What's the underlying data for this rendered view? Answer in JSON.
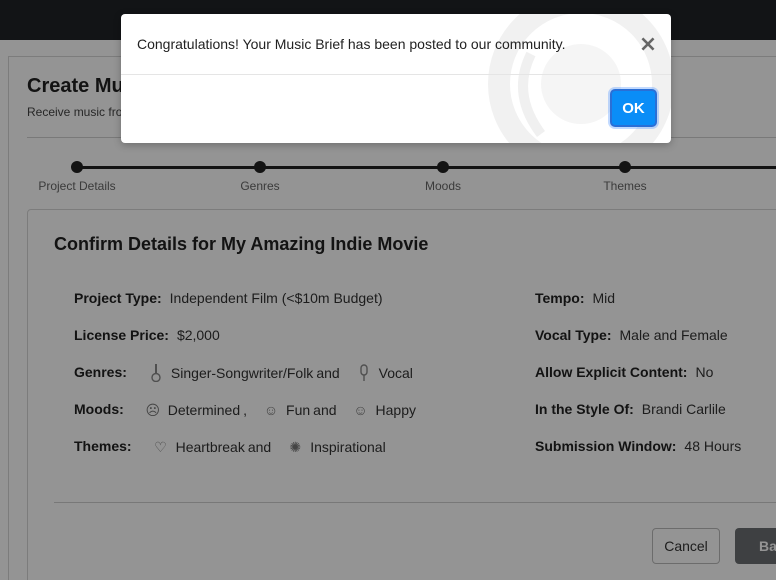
{
  "page": {
    "title": "Create Music Brief",
    "subtitle": "Receive music from our community"
  },
  "steps": [
    {
      "label": "Project Details"
    },
    {
      "label": "Genres"
    },
    {
      "label": "Moods"
    },
    {
      "label": "Themes"
    }
  ],
  "confirm": {
    "title": "Confirm Details for My Amazing Indie Movie",
    "left": {
      "project_type": {
        "label": "Project Type:",
        "value": "Independent Film (<$10m Budget)"
      },
      "license_price": {
        "label": "License Price:",
        "value": "$2,000"
      },
      "genres": {
        "label": "Genres:",
        "items": [
          {
            "icon": "guitar-icon",
            "name": "Singer-Songwriter/Folk",
            "joiner": "and"
          },
          {
            "icon": "microphone-icon",
            "name": "Vocal",
            "joiner": ""
          }
        ]
      },
      "moods": {
        "label": "Moods:",
        "items": [
          {
            "icon": "determined-face-icon",
            "name": "Determined",
            "joiner": ","
          },
          {
            "icon": "grin-face-icon",
            "name": "Fun",
            "joiner": "and"
          },
          {
            "icon": "happy-face-icon",
            "name": "Happy",
            "joiner": ""
          }
        ]
      },
      "themes": {
        "label": "Themes:",
        "items": [
          {
            "icon": "broken-heart-icon",
            "name": "Heartbreak",
            "joiner": "and"
          },
          {
            "icon": "lightbulb-icon",
            "name": "Inspirational",
            "joiner": ""
          }
        ]
      }
    },
    "right": {
      "tempo": {
        "label": "Tempo:",
        "value": "Mid"
      },
      "vocal_type": {
        "label": "Vocal Type:",
        "value": "Male and Female"
      },
      "explicit": {
        "label": "Allow Explicit Content:",
        "value": "No"
      },
      "style": {
        "label": "In the Style Of:",
        "value": "Brandi Carlile"
      },
      "window": {
        "label": "Submission Window:",
        "value": "48 Hours"
      }
    },
    "buttons": {
      "cancel": "Cancel",
      "back": "Back"
    }
  },
  "modal": {
    "message": "Congratulations! Your Music Brief has been posted to our community.",
    "close": "×",
    "ok": "OK"
  },
  "colors": {
    "primary": "#0a8df7",
    "topbar": "#1f2326"
  }
}
